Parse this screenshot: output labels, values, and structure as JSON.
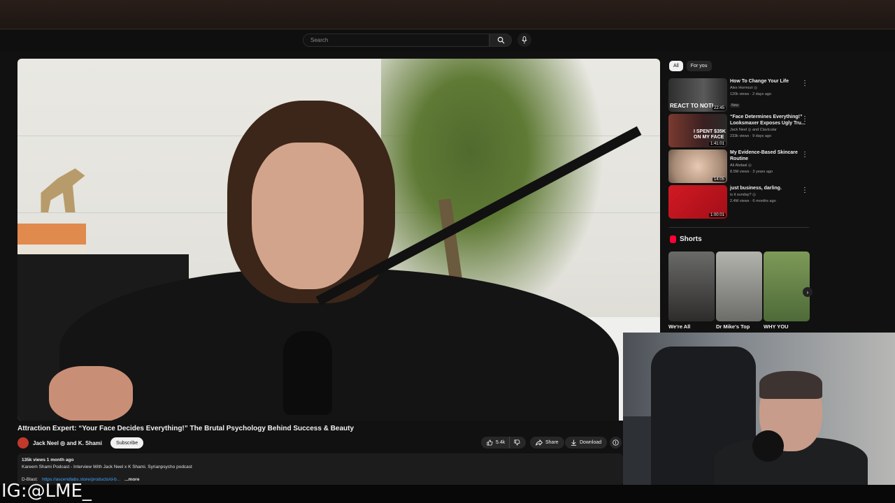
{
  "search": {
    "placeholder": "Search"
  },
  "video": {
    "title": "Attraction Expert: “Your Face Decides Everything!” The Brutal Psychology Behind Success & Beauty",
    "channel": "Jack Neel ◎ and K. Shami",
    "subscribe_label": "Subscribe",
    "likes": "5.4k",
    "share_label": "Share",
    "download_label": "Download"
  },
  "description": {
    "meta": "135k views  1 month ago",
    "line1": "Kareem Shami Podcast - Interview With Jack Neel x K Shami. Syrianpsycho podcast",
    "line2_prefix": "D-Blast:",
    "line2_link": "https://ascendlabs.store/products/d-b...",
    "more": "...more"
  },
  "chips": [
    {
      "label": "All",
      "active": true
    },
    {
      "label": "For you",
      "active": false
    }
  ],
  "recommendations": [
    {
      "title": "How To Change Your Life",
      "channel": "Alex Hormozi ◎",
      "stats": "120k views · 2 days ago",
      "badge": "New",
      "duration": "22:45",
      "thumb_text": "REACT TO NOTI",
      "thumb_color": "#3a3a3a"
    },
    {
      "title": "“Face Determines Everything!” Looksmaxer Exposes Ugly Tru...",
      "channel": "Jack Neel ◎ and Clavicular",
      "stats": "233k views · 9 days ago",
      "badge": "",
      "duration": "1:41:01",
      "thumb_text": "I SPENT $35K ON MY FACE",
      "thumb_color": "#5a2a2a"
    },
    {
      "title": "My Evidence-Based Skincare Routine",
      "channel": "Ali Abdaal ◎",
      "stats": "8.5M views · 3 years ago",
      "badge": "",
      "duration": "14:05",
      "thumb_text": "",
      "thumb_color": "#c8b39e"
    },
    {
      "title": "just business, darling.",
      "channel": "is it sunday? ◎",
      "stats": "2.4M views · 6 months ago",
      "badge": "",
      "duration": "1:00:01",
      "thumb_text": "",
      "thumb_color": "#c0121c"
    }
  ],
  "shorts": {
    "heading": "Shorts",
    "items": [
      {
        "label": "We're All",
        "color": "#3d3c3a"
      },
      {
        "label": "Dr Mike's Top",
        "color": "#8a8a86"
      },
      {
        "label": "WHY YOU",
        "color": "#6c8a4a"
      }
    ]
  },
  "overlay": {
    "watermark": "IG:@LME_"
  },
  "colors": {
    "accent": "#ff0033",
    "link": "#3ea6ff"
  }
}
